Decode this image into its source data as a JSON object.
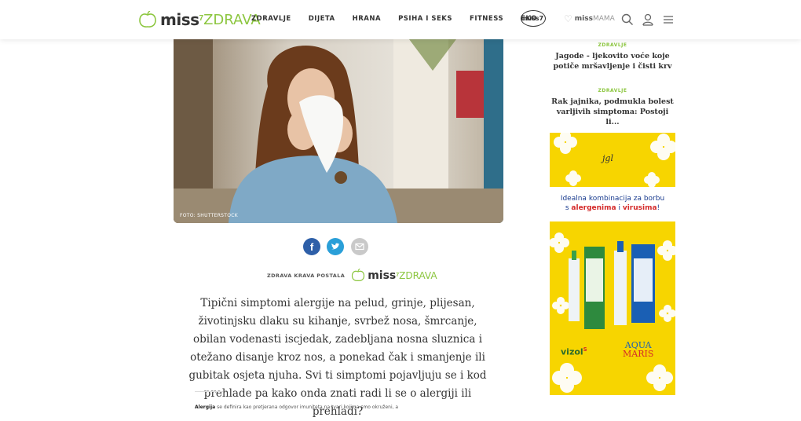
{
  "header": {
    "logo_miss": "miss",
    "logo_sup": "7",
    "logo_zdrava": "ZDRAVA",
    "nav": [
      "ZDRAVLJE",
      "DIJETA",
      "HRANA",
      "PSIHA I SEKS",
      "FITNESS",
      "EKO"
    ],
    "miss7_badge": "miss7",
    "mama_miss": "miss",
    "mama_label": "MAMA",
    "icons": [
      "search-icon",
      "user-icon",
      "menu-icon"
    ]
  },
  "hero": {
    "photo_credit": "FOTO: SHUTTERSTOCK"
  },
  "share": [
    "facebook-icon",
    "twitter-icon",
    "email-icon"
  ],
  "byline": {
    "prefix": "ZDRAVA KRAVA POSTALA",
    "miss": "miss",
    "sup": "7",
    "zdrava": "ZDRAVA"
  },
  "lead": "Tipični simptomi alergije na pelud, grinje, plijesan, životinjsku dlaku su kihanje, svrbež nosa, šmrcanje, obilan vodenasti iscjedak, zadebljana nosna sluznica i otežano disanje kroz nos, a ponekad čak i smanjenje ili gubitak osjeta njuha. Svi ti simptomi pojavljuju se i kod prehlade pa kako onda znati radi li se o alergiji ili prehladi?",
  "body_start": {
    "bold": "Alergija",
    "rest": " se definira kao pretjerana odgovor imuniteta na tvari kojima smo okruženi, a"
  },
  "sidebar": [
    {
      "category": "ZDRAVLJE",
      "title": "Jagode - ljekovito voće koje potiče mršavljenje i čisti krv"
    },
    {
      "category": "ZDRAVLJE",
      "title": "Rak jajnika, podmukla bolest varljivih simptoma: Postoji li..."
    }
  ],
  "ad": {
    "brand": "jgl",
    "headline_1": "Idealna kombinacija za borbu",
    "headline_2_pre": "s ",
    "headline_2_b1": "alergenima",
    "headline_2_mid": " i ",
    "headline_2_b2": "virusima",
    "headline_2_post": "!",
    "product_1": "vizol",
    "product_1_sup": "S",
    "product_2_a": "AQUA",
    "product_2_b": "MARIS",
    "colors": {
      "yellow": "#f7d500",
      "blue": "#1a3c8f",
      "red": "#d42a2a"
    }
  },
  "colors": {
    "accent_green": "#8cc63f"
  }
}
